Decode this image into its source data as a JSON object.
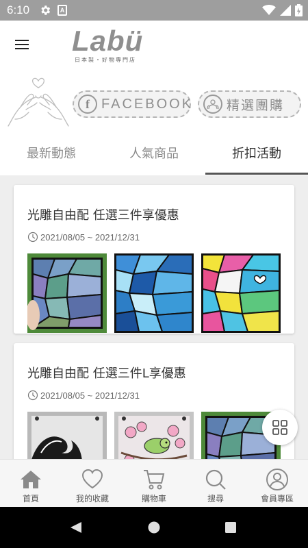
{
  "status_bar": {
    "time": "6:10"
  },
  "header": {
    "logo_text": "Labü",
    "logo_subtitle": "日本製・好物專門店"
  },
  "banner": {
    "facebook_label": "FACEBOOK",
    "facebook_icon": "f",
    "group_buy_label": "精選團購"
  },
  "tabs": [
    {
      "label": "最新動態",
      "active": false
    },
    {
      "label": "人氣商品",
      "active": false
    },
    {
      "label": "折扣活動",
      "active": true
    }
  ],
  "cards": [
    {
      "title": "光雕自由配 任選三件享優惠",
      "date": "2021/08/05 ~ 2021/12/31",
      "images": [
        "stained-glass-green-purple",
        "stained-glass-blue",
        "stained-glass-colorful-butterfly"
      ]
    },
    {
      "title": "光雕自由配 任選三件L享優惠",
      "date": "2021/08/05 ~ 2021/12/31",
      "images": [
        "great-wave",
        "bird-cherry-blossom",
        "stained-glass-green-purple"
      ]
    }
  ],
  "bottom_nav": [
    {
      "label": "首頁",
      "icon": "home-icon"
    },
    {
      "label": "我的收藏",
      "icon": "heart-icon"
    },
    {
      "label": "購物車",
      "icon": "cart-icon"
    },
    {
      "label": "搜尋",
      "icon": "search-icon"
    },
    {
      "label": "會員專區",
      "icon": "user-icon"
    }
  ],
  "colors": {
    "status_bar": "#9e9e9e",
    "feed_background": "#eeeeee",
    "nav_icon": "#8a8a8a",
    "tab_active": "#333333",
    "tab_inactive": "#8a8a8a"
  }
}
